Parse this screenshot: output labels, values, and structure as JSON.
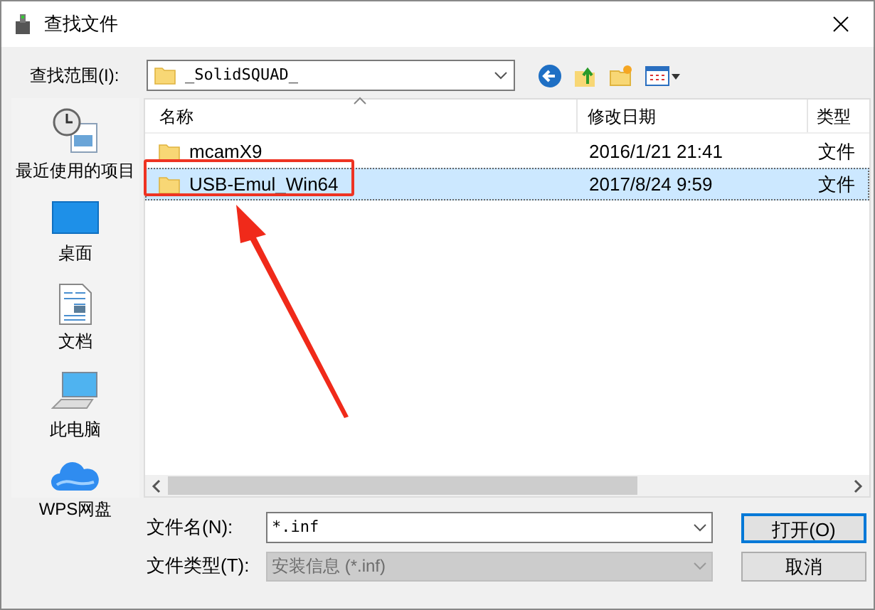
{
  "window": {
    "title": "查找文件"
  },
  "look_in": {
    "label": "查找范围(I):",
    "value": "_SolidSQUAD_"
  },
  "sidebar": {
    "items": [
      {
        "label": "最近使用的项目",
        "kind": "recent",
        "selected": false
      },
      {
        "label": "桌面",
        "kind": "desktop",
        "selected": false
      },
      {
        "label": "文档",
        "kind": "documents",
        "selected": false
      },
      {
        "label": "此电脑",
        "kind": "computer",
        "selected": false
      },
      {
        "label": "WPS网盘",
        "kind": "cloud",
        "selected": false
      }
    ]
  },
  "table": {
    "columns": [
      "名称",
      "修改日期",
      "类型"
    ],
    "rows": [
      {
        "name": "mcamX9",
        "date": "2016/1/21 21:41",
        "type": "文件",
        "selected": false
      },
      {
        "name": "USB-Emul_Win64",
        "date": "2017/8/24 9:59",
        "type": "文件",
        "selected": true
      }
    ]
  },
  "file_name": {
    "label": "文件名(N):",
    "value": "*.inf"
  },
  "file_type": {
    "label": "文件类型(T):",
    "value": "安装信息 (*.inf)",
    "disabled": true
  },
  "buttons": [
    {
      "label": "打开(O)",
      "default": true
    },
    {
      "label": "取消",
      "default": false
    }
  ]
}
